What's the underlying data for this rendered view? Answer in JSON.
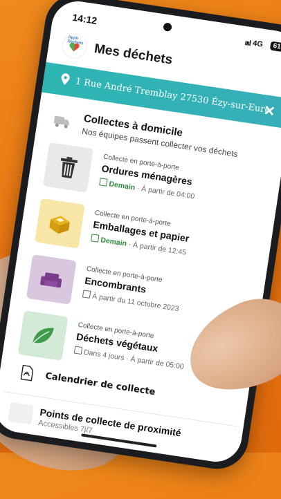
{
  "status_bar": {
    "time": "14:12",
    "signal": "ıııl",
    "network": "4G",
    "battery": "61"
  },
  "app": {
    "logo_text": "Appli Déchets",
    "title": "Mes déchets"
  },
  "address_bar": {
    "address": "1 Rue André Tremblay 27530 Ézy-sur-Eure",
    "close_label": "✕"
  },
  "home_collection": {
    "title": "Collectes à domicile",
    "subtitle": "Nos équipes passent collecter vos déchets"
  },
  "collections": [
    {
      "kind": "Collecte en porte-à-porte",
      "name": "Ordures ménagères",
      "when": "Demain",
      "detail": " · À partir de 04:00",
      "tile_color": "#e9e9ea",
      "icon": "trash-bin-icon",
      "highlight": true
    },
    {
      "kind": "Collecte en porte-à-porte",
      "name": "Emballages et papier",
      "when": "Demain",
      "detail": " · À partir de 12:45",
      "tile_color": "#f7e6a6",
      "icon": "packaging-icon",
      "highlight": true
    },
    {
      "kind": "Collecte en porte-à-porte",
      "name": "Encombrants",
      "when": "",
      "detail": "À partir du 11 octobre 2023",
      "tile_color": "#d9c6df",
      "icon": "sofa-icon",
      "highlight": false
    },
    {
      "kind": "Collecte en porte-à-porte",
      "name": "Déchets végétaux",
      "when": "",
      "detail": "Dans 4 jours · À partir de 05:00",
      "tile_color": "#d2ead6",
      "icon": "leaf-icon",
      "highlight": false
    }
  ],
  "calendar": {
    "label": "Calendrier de collecte"
  },
  "drop_points": {
    "title": "Points de collecte de proximité",
    "subtitle": "Accessibles 7j/7"
  },
  "colors": {
    "accent": "#2db6b2",
    "green": "#2e8a3a",
    "background": "#ea7410"
  }
}
